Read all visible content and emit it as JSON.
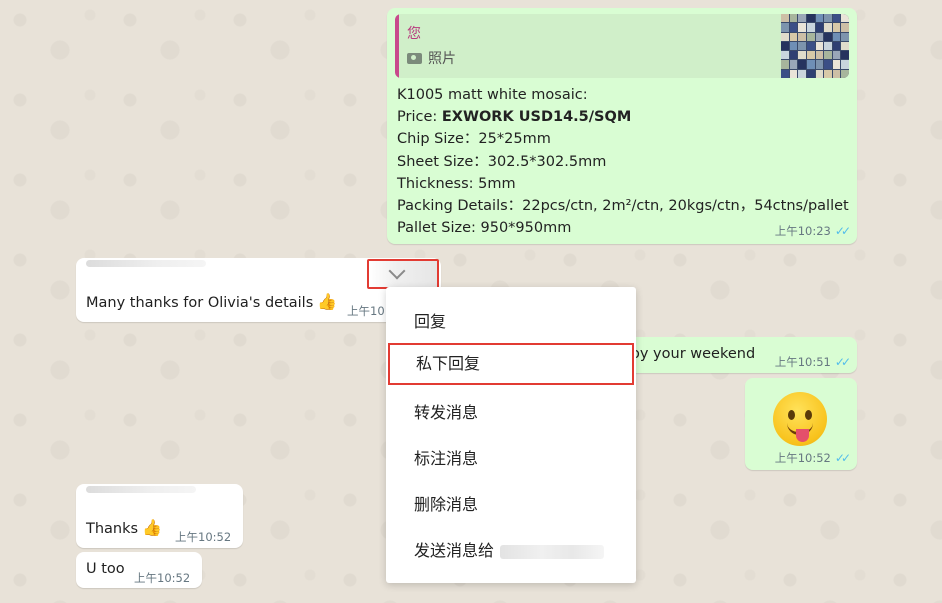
{
  "quoted": {
    "author": "您",
    "media_label": "照片"
  },
  "product_message": {
    "lines": [
      "K1005 matt white mosaic:",
      "Price: ",
      "Chip Size：25*25mm",
      "Sheet Size：302.5*302.5mm",
      "Thickness: 5mm",
      "Packing Details：22pcs/ctn, 2m²/ctn, 20kgs/ctn，54ctns/pallet",
      "Pallet Size: 950*950mm"
    ],
    "price_bold": "EXWORK USD14.5/SQM",
    "time": "上午10:23"
  },
  "incoming_thanks_olivia": {
    "text": "Many thanks for Olivia's details",
    "emoji": "👍",
    "time": "上午10"
  },
  "outgoing_weekend": {
    "text": "oy your weekend",
    "time": "上午10:51"
  },
  "outgoing_emoji": {
    "time": "上午10:52"
  },
  "incoming_thanks": {
    "text": "Thanks",
    "emoji": "👍",
    "time": "上午10:52"
  },
  "incoming_utoo": {
    "text": "U too",
    "time": "上午10:52"
  },
  "context_menu": {
    "items": [
      "回复",
      "私下回复",
      "转发消息",
      "标注消息",
      "删除消息",
      "发送消息给"
    ],
    "highlighted_index": 1
  },
  "colors": {
    "outgoing_bubble": "#d9fdd3",
    "incoming_bubble": "#ffffff",
    "highlight_border": "#e23b33",
    "read_ticks": "#53bdeb",
    "quote_accent": "#c84a8c"
  }
}
